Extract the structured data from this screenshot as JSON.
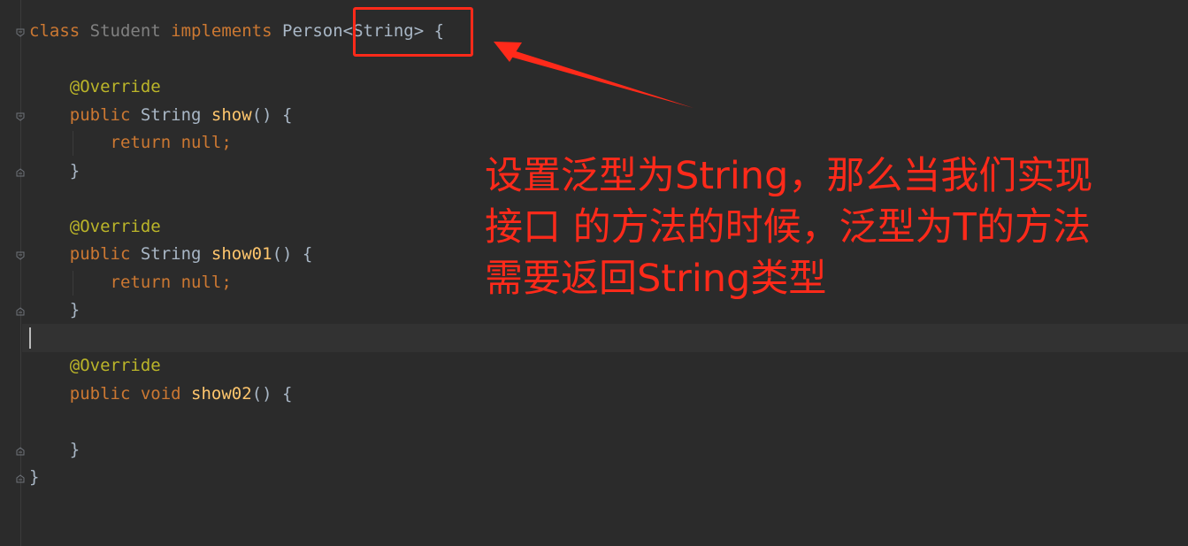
{
  "editor": {
    "lines": [
      [
        {
          "t": "class ",
          "c": "kw"
        },
        {
          "t": "Student ",
          "c": "dim"
        },
        {
          "t": "implements ",
          "c": "kw"
        },
        {
          "t": "Person",
          "c": "plain"
        },
        {
          "t": "<String> {",
          "c": "plain"
        }
      ],
      [],
      [
        {
          "t": "    ",
          "c": "plain"
        },
        {
          "t": "@Override",
          "c": "ann"
        }
      ],
      [
        {
          "t": "    ",
          "c": "plain"
        },
        {
          "t": "public ",
          "c": "kw"
        },
        {
          "t": "String ",
          "c": "plain"
        },
        {
          "t": "show",
          "c": "fn"
        },
        {
          "t": "() {",
          "c": "plain"
        }
      ],
      [
        {
          "t": "        ",
          "c": "plain"
        },
        {
          "t": "return ",
          "c": "kw"
        },
        {
          "t": "null",
          "c": "kw"
        },
        {
          "t": ";",
          "c": "kw"
        }
      ],
      [
        {
          "t": "    }",
          "c": "plain"
        }
      ],
      [],
      [
        {
          "t": "    ",
          "c": "plain"
        },
        {
          "t": "@Override",
          "c": "ann"
        }
      ],
      [
        {
          "t": "    ",
          "c": "plain"
        },
        {
          "t": "public ",
          "c": "kw"
        },
        {
          "t": "String ",
          "c": "plain"
        },
        {
          "t": "show01",
          "c": "fn"
        },
        {
          "t": "() {",
          "c": "plain"
        }
      ],
      [
        {
          "t": "        ",
          "c": "plain"
        },
        {
          "t": "return ",
          "c": "kw"
        },
        {
          "t": "null",
          "c": "kw"
        },
        {
          "t": ";",
          "c": "kw"
        }
      ],
      [
        {
          "t": "    }",
          "c": "plain"
        }
      ],
      [],
      [
        {
          "t": "    ",
          "c": "plain"
        },
        {
          "t": "@Override",
          "c": "ann"
        }
      ],
      [
        {
          "t": "    ",
          "c": "plain"
        },
        {
          "t": "public ",
          "c": "kw"
        },
        {
          "t": "void ",
          "c": "kw"
        },
        {
          "t": "show02",
          "c": "fn"
        },
        {
          "t": "() {",
          "c": "plain"
        }
      ],
      [],
      [
        {
          "t": "    }",
          "c": "plain"
        }
      ],
      [
        {
          "t": "}",
          "c": "plain"
        }
      ]
    ]
  },
  "annotation": {
    "line1": "设置泛型为String，那么当我们实现",
    "line2": "接口 的方法的时候，泛型为T的方法",
    "line3": "需要返回String类型"
  },
  "colors": {
    "background": "#2b2b2b",
    "keyword": "#cc7832",
    "function": "#ffc66d",
    "annotation_color": "#bbb529",
    "annotation_text": "#ff2a1a"
  }
}
